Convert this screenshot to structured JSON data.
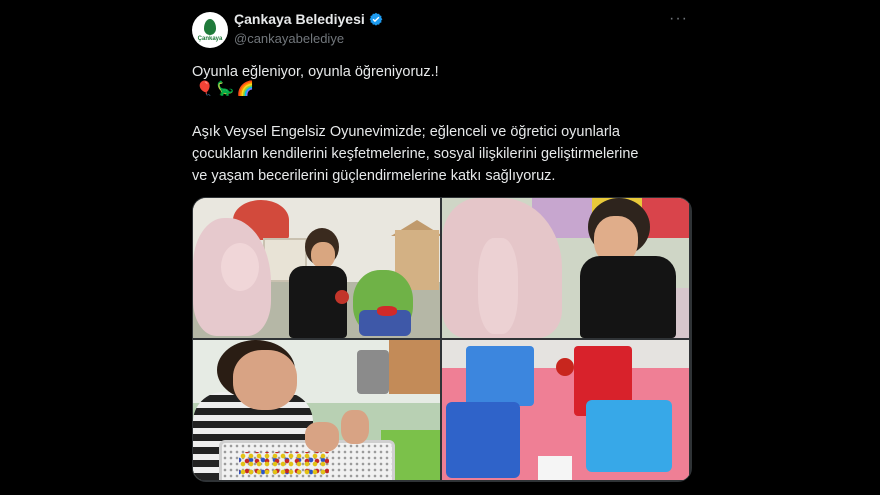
{
  "account": {
    "display_name": "Çankaya Belediyesi",
    "handle": "@cankayabelediye",
    "avatar_text": "Çankaya",
    "verified": true
  },
  "more_label": "···",
  "tweet": {
    "line1": "Oyunla eğleniyor, oyunla öğreniyoruz.!",
    "emojis": [
      "🎈",
      "🦕",
      "🌈"
    ],
    "body": "Aşık Veysel Engelsiz Oyunevimizde; eğlenceli ve öğretici oyunlarla\nçocukların kendilerini keşfetmelerine, sosyal ilişkilerini geliştirmelerine\nve yaşam becerilerini güçlendirmelerine katkı sağlıyoruz."
  },
  "colors": {
    "background": "#000000",
    "text": "#e7e9ea",
    "secondary": "#71767b",
    "verified": "#1d9bf0"
  }
}
